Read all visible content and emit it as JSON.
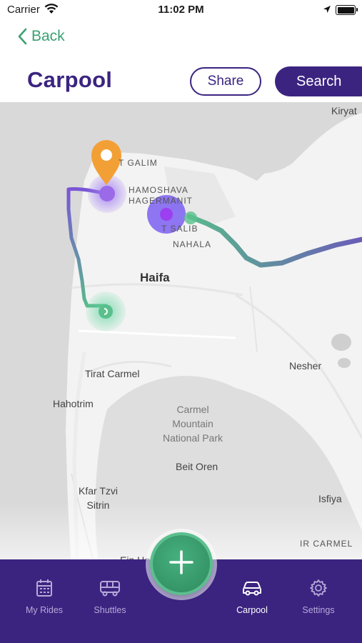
{
  "status_bar": {
    "carrier": "Carrier",
    "time": "11:02 PM"
  },
  "nav": {
    "back_label": "Back"
  },
  "header": {
    "title": "Carpool",
    "share_label": "Share",
    "search_label": "Search"
  },
  "map": {
    "labels": {
      "kiryat": "Kiryat",
      "galim": "T GALIM",
      "hamoshava": "HAMOSHAVA",
      "hagermanit": "HAGERMANIT",
      "salib": "T SALIB",
      "nahala": "NAHALA",
      "haifa": "Haifa",
      "tirat_carmel": "Tirat Carmel",
      "nesher": "Nesher",
      "hahotrim": "Hahotrim",
      "carmel_park_1": "Carmel",
      "carmel_park_2": "Mountain",
      "carmel_park_3": "National Park",
      "beit_oren": "Beit Oren",
      "kfar_tzvi_1": "Kfar Tzvi",
      "kfar_tzvi_2": "Sitrin",
      "isfiya": "Isfiya",
      "ir_carmel": "IR CARMEL",
      "ein_hod": "Ein Ho"
    },
    "colors": {
      "route_start": "#7a55d6",
      "route_end": "#59b98c",
      "pin": "#f2a035"
    }
  },
  "tabbar": {
    "items": [
      {
        "label": "My Rides",
        "icon": "calendar-icon"
      },
      {
        "label": "Shuttles",
        "icon": "bus-icon"
      },
      {
        "label": "Carpool",
        "icon": "car-icon"
      },
      {
        "label": "Settings",
        "icon": "gear-icon"
      }
    ],
    "active": "Carpool"
  },
  "colors": {
    "brand_purple": "#3b2480",
    "accent_green": "#3aa173"
  }
}
